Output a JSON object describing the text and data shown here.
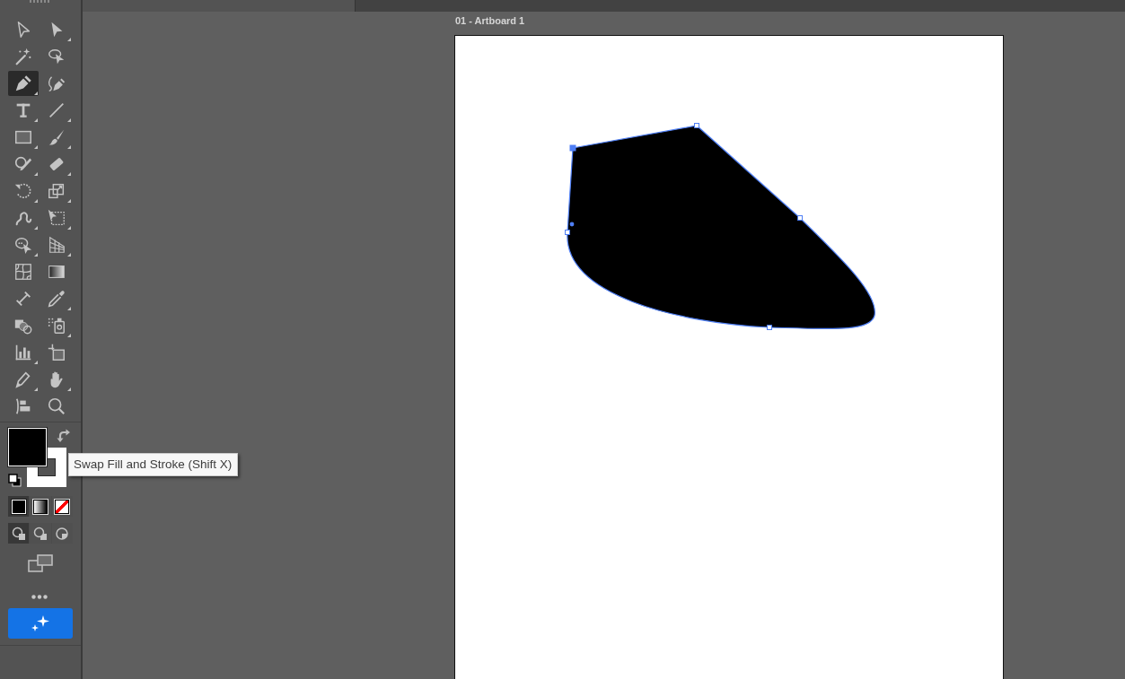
{
  "toolbar": {
    "tools": [
      {
        "kind": "selection",
        "selected": false,
        "grouped": false
      },
      {
        "kind": "direct",
        "selected": false,
        "grouped": true
      },
      {
        "kind": "wand",
        "selected": false,
        "grouped": false
      },
      {
        "kind": "lasso",
        "selected": false,
        "grouped": false
      },
      {
        "kind": "pen",
        "selected": true,
        "grouped": true
      },
      {
        "kind": "curvature",
        "selected": false,
        "grouped": false
      },
      {
        "kind": "type",
        "selected": false,
        "grouped": true
      },
      {
        "kind": "line",
        "selected": false,
        "grouped": true
      },
      {
        "kind": "rectangle",
        "selected": false,
        "grouped": true
      },
      {
        "kind": "brush",
        "selected": false,
        "grouped": true
      },
      {
        "kind": "shaper",
        "selected": false,
        "grouped": true
      },
      {
        "kind": "eraser",
        "selected": false,
        "grouped": true
      },
      {
        "kind": "rotate",
        "selected": false,
        "grouped": true
      },
      {
        "kind": "scale",
        "selected": false,
        "grouped": true
      },
      {
        "kind": "warp",
        "selected": false,
        "grouped": true
      },
      {
        "kind": "transform",
        "selected": false,
        "grouped": true
      },
      {
        "kind": "builder",
        "selected": false,
        "grouped": true
      },
      {
        "kind": "perspective",
        "selected": false,
        "grouped": true
      },
      {
        "kind": "mesh",
        "selected": false,
        "grouped": false
      },
      {
        "kind": "gradient",
        "selected": false,
        "grouped": false
      },
      {
        "kind": "blend",
        "selected": false,
        "grouped": false
      },
      {
        "kind": "eyedropper",
        "selected": false,
        "grouped": true
      },
      {
        "kind": "livepaint",
        "selected": false,
        "grouped": false
      },
      {
        "kind": "sprayer",
        "selected": false,
        "grouped": true
      },
      {
        "kind": "graph",
        "selected": false,
        "grouped": true
      },
      {
        "kind": "artboard",
        "selected": false,
        "grouped": false
      },
      {
        "kind": "pencil",
        "selected": false,
        "grouped": true
      },
      {
        "kind": "hand",
        "selected": false,
        "grouped": true
      },
      {
        "kind": "flag",
        "selected": false,
        "grouped": false
      },
      {
        "kind": "zoom",
        "selected": false,
        "grouped": false
      }
    ],
    "swatches": [
      {
        "kind": "fill",
        "color": "#000000"
      },
      {
        "kind": "stroke",
        "color": "#ffffff"
      }
    ],
    "color_modes": [
      {
        "kind": "color",
        "selected": true
      },
      {
        "kind": "gradient",
        "selected": false
      },
      {
        "kind": "none",
        "selected": false
      }
    ],
    "draw_modes": [
      {
        "kind": "normal",
        "selected": true
      },
      {
        "kind": "behind",
        "selected": false
      },
      {
        "kind": "inside",
        "selected": false
      }
    ]
  },
  "tooltip": {
    "text": "Swap Fill and Stroke (Shift X)"
  },
  "artboard": {
    "label": "01 - Artboard 1",
    "anchors": [
      {
        "selected": true
      },
      {
        "selected": false
      },
      {
        "selected": false
      },
      {
        "selected": false
      },
      {
        "selected": false
      }
    ]
  }
}
